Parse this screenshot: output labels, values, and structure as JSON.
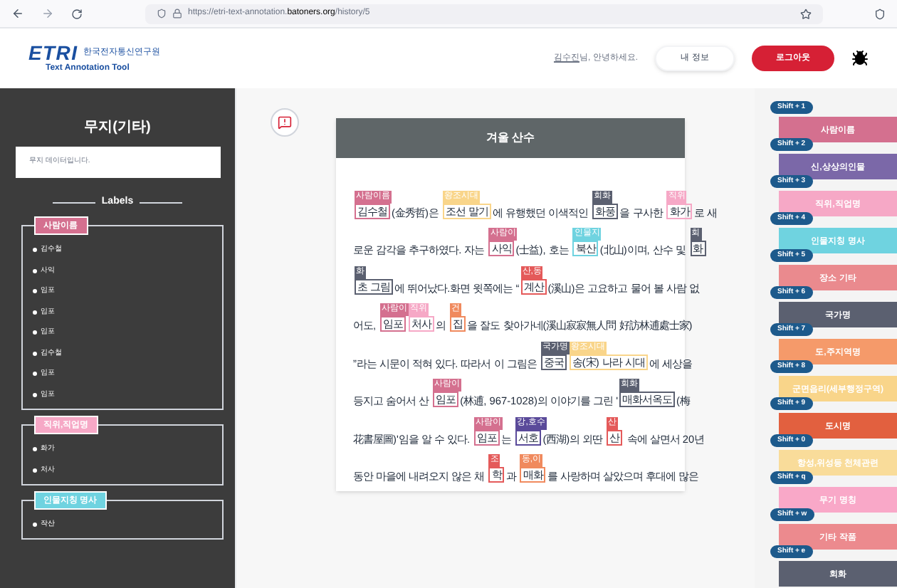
{
  "browser": {
    "url_prefix": "https://etri-text-annotation.",
    "url_domain": "batoners.org",
    "url_path": "/history/5"
  },
  "header": {
    "logo": "ETRI",
    "logo_org": "한국전자통신연구원",
    "subtitle": "Text Annotation Tool",
    "user": "김수진",
    "greeting": "님, 안녕하세요.",
    "buttons": [
      {
        "label": "내 정보",
        "kind": "plain"
      },
      {
        "label": "로그아웃",
        "kind": "primary"
      }
    ]
  },
  "sidebar": {
    "title": "무지(기타)",
    "description": "무지 데이터입니다.",
    "labels_heading": "Labels",
    "groups": [
      {
        "label": "사람이름",
        "color": "#d4708f",
        "items": [
          "김수철",
          "사익",
          "임포",
          "임포",
          "임포",
          "김수철",
          "임포",
          "임포"
        ]
      },
      {
        "label": "직위,직업명",
        "color": "#f6a8c6",
        "items": [
          "화가",
          "처사"
        ]
      },
      {
        "label": "인물지칭 명사",
        "color": "#6fd3e0",
        "items": [
          "작산"
        ]
      }
    ]
  },
  "document": {
    "title": "겨울 산수",
    "lines": [
      [
        {
          "text": "김수철",
          "tag": "사람이름",
          "color": "#d4708f"
        },
        {
          "text": "(金秀哲)은 "
        },
        {
          "text": "조선 말기",
          "tag": "왕조시대",
          "color": "#f9d58a"
        },
        {
          "text": "에 유행했던 이색적인 "
        },
        {
          "text": "화풍",
          "tag": "회화",
          "color": "#5b6070"
        },
        {
          "text": "을 구사한 "
        },
        {
          "text": "화가",
          "tag": "직위",
          "color": "#f6a8c6"
        },
        {
          "text": "로 새"
        }
      ],
      [
        {
          "text": "로운 감각을 추구하였다. 자는 "
        },
        {
          "text": "사익",
          "tag": "사람이",
          "color": "#d4708f"
        },
        {
          "text": "(士益), 호는 "
        },
        {
          "text": "북산",
          "tag": "인물지",
          "color": "#6fd3e0"
        },
        {
          "text": "(北山)이며, 산수 및 "
        },
        {
          "text": "화",
          "tag": "회",
          "color": "#5b6070"
        }
      ],
      [
        {
          "text": "초 그림",
          "tag": "화",
          "color": "#5b6070"
        },
        {
          "text": "에 뛰어났다.화면 윗쪽에는 “"
        },
        {
          "text": "계산",
          "tag": "산,동",
          "color": "#e45a5a"
        },
        {
          "text": "(溪山)은 고요하고 물어 볼 사람 없"
        }
      ],
      [
        {
          "text": "어도, "
        },
        {
          "text": "임포",
          "tag": "사람이",
          "color": "#d4708f"
        },
        {
          "text": "처사",
          "tag": "직위",
          "color": "#f6a8c6"
        },
        {
          "text": "의 "
        },
        {
          "text": "집",
          "tag": "건",
          "color": "#f08a5e"
        },
        {
          "text": "을 잘도 찾아가네(溪山寂寂無人問 好訪林逋處士家)"
        }
      ],
      [
        {
          "text": "”라는 시문이 적혀 있다. 따라서 이 그림은 "
        },
        {
          "text": "중국",
          "tag": "국가명",
          "color": "#5b6070"
        },
        {
          "text": "송(宋) 나라 시대",
          "tag": "왕조시대",
          "color": "#f9d58a"
        },
        {
          "text": "에 세상을"
        }
      ],
      [
        {
          "text": "등지고 숨어서 산 "
        },
        {
          "text": "임포",
          "tag": "사람이",
          "color": "#d4708f"
        },
        {
          "text": "(林逋, 967-1028)의 이야기를 그린 '"
        },
        {
          "text": "매화서옥도",
          "tag": "회화",
          "color": "#5b6070"
        },
        {
          "text": "(梅"
        }
      ],
      [
        {
          "text": "花書屋圖)'임을 알 수 있다. "
        },
        {
          "text": "임포",
          "tag": "사람이",
          "color": "#d4708f"
        },
        {
          "text": "는 "
        },
        {
          "text": "서호",
          "tag": "강,호수",
          "color": "#5a4a9a"
        },
        {
          "text": "(西湖)의 외딴 "
        },
        {
          "text": "산",
          "tag": "산",
          "color": "#e45a5a"
        },
        {
          "text": " 속에 살면서 20년"
        }
      ],
      [
        {
          "text": "동안 마을에 내려오지 않은 채 "
        },
        {
          "text": "학",
          "tag": "조",
          "color": "#e45a5a"
        },
        {
          "text": "과 "
        },
        {
          "text": "매화",
          "tag": "동,이",
          "color": "#f08a5e"
        },
        {
          "text": "를 사랑하며 살았으며 후대에 많은"
        }
      ]
    ]
  },
  "label_buttons": [
    {
      "shortcut": "Shift + 1",
      "label": "사람이름",
      "color": "#d4708f"
    },
    {
      "shortcut": "Shift + 2",
      "label": "신,상상의인물",
      "color": "#7b68a8"
    },
    {
      "shortcut": "Shift + 3",
      "label": "직위,직업명",
      "color": "#f6a8c6"
    },
    {
      "shortcut": "Shift + 4",
      "label": "인물지칭 명사",
      "color": "#6fd3e0"
    },
    {
      "shortcut": "Shift + 5",
      "label": "장소 기타",
      "color": "#ea8a8e"
    },
    {
      "shortcut": "Shift + 6",
      "label": "국가명",
      "color": "#5b6070"
    },
    {
      "shortcut": "Shift + 7",
      "label": "도,주지역명",
      "color": "#f59a6a"
    },
    {
      "shortcut": "Shift + 8",
      "label": "군면읍리(세부행정구역)",
      "color": "#f9d58a"
    },
    {
      "shortcut": "Shift + 9",
      "label": "도시명",
      "color": "#e2603f"
    },
    {
      "shortcut": "Shift + 0",
      "label": "항성,위성등 천체관련",
      "color": "#f9dc9a"
    },
    {
      "shortcut": "Shift + q",
      "label": "무기 명칭",
      "color": "#f9a8c8"
    },
    {
      "shortcut": "Shift + w",
      "label": "기타 작품",
      "color": "#ec8a8e"
    },
    {
      "shortcut": "Shift + e",
      "label": "회화",
      "color": "#5b6070"
    }
  ]
}
